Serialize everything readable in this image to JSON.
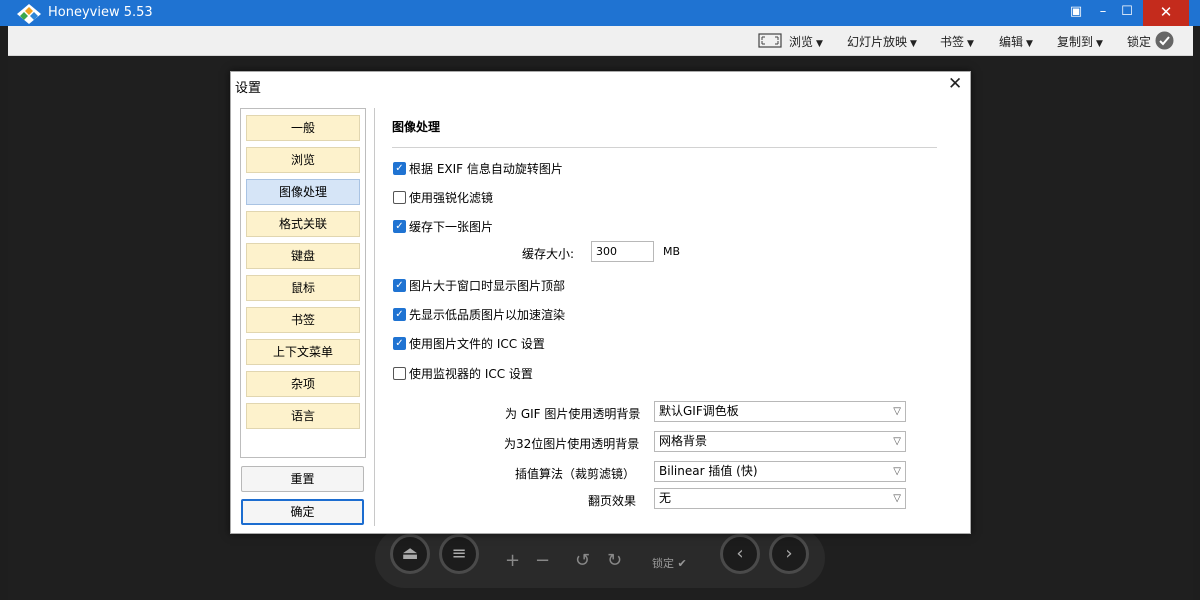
{
  "window": {
    "title": "Honeyview 5.53"
  },
  "toolbar": {
    "items": [
      "浏览",
      "幻灯片放映",
      "书签",
      "编辑",
      "复制到"
    ],
    "lock_label": "锁定"
  },
  "dialog": {
    "title": "设置",
    "nav_items": [
      "一般",
      "浏览",
      "图像处理",
      "格式关联",
      "键盘",
      "鼠标",
      "书签",
      "上下文菜单",
      "杂项",
      "语言"
    ],
    "active_nav": "图像处理",
    "reset_label": "重置",
    "ok_label": "确定",
    "section_title": "图像处理",
    "options": [
      {
        "label": "根据 EXIF 信息自动旋转图片",
        "checked": true
      },
      {
        "label": "使用强锐化滤镜",
        "checked": false
      },
      {
        "label": "缓存下一张图片",
        "checked": true
      },
      {
        "label": "图片大于窗口时显示图片顶部",
        "checked": true
      },
      {
        "label": "先显示低品质图片以加速渲染",
        "checked": true
      },
      {
        "label": "使用图片文件的 ICC 设置",
        "checked": true
      },
      {
        "label": "使用监视器的 ICC 设置",
        "checked": false
      }
    ],
    "cache_size_label": "缓存大小:",
    "cache_size_value": "300",
    "cache_size_unit": "MB",
    "selects": [
      {
        "label": "为 GIF 图片使用透明背景",
        "value": "默认GIF调色板"
      },
      {
        "label": "为32位图片使用透明背景",
        "value": "网格背景"
      },
      {
        "label": "插值算法（裁剪滤镜）",
        "value": "Bilinear 插值 (快)"
      },
      {
        "label": "翻页效果",
        "value": "无"
      }
    ]
  },
  "bottom_bar": {
    "lock_label": "锁定"
  },
  "colors": {
    "titlebar": "#1f73d2",
    "nav_item_bg": "#fdf2cc",
    "nav_active_bg": "#d6e5f7",
    "checkbox_on": "#1f73d2"
  }
}
